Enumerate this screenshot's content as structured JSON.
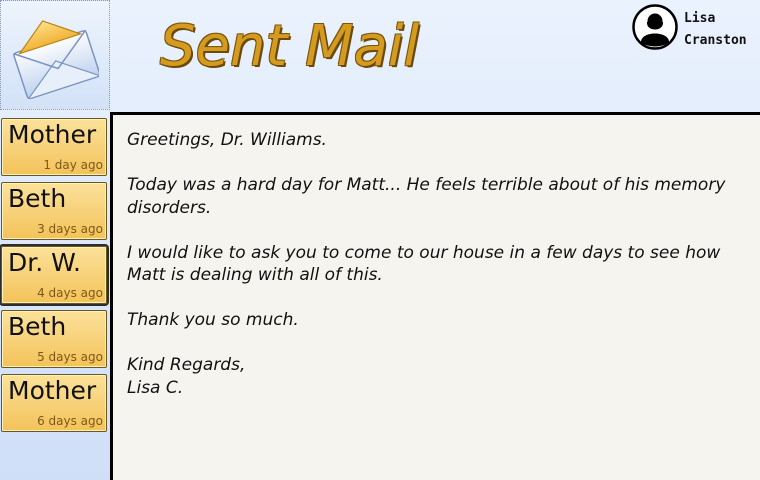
{
  "header": {
    "title": "Sent Mail",
    "logo_icon": "envelope-icon",
    "user": {
      "first_name": "Lisa",
      "last_name": "Cranston",
      "avatar_icon": "user-silhouette-icon"
    }
  },
  "sidebar": {
    "items": [
      {
        "name": "Mother",
        "time": "1 day ago",
        "active": false
      },
      {
        "name": "Beth",
        "time": "3 days ago",
        "active": false
      },
      {
        "name": "Dr. W.",
        "time": "4 days ago",
        "active": true
      },
      {
        "name": "Beth",
        "time": "5 days ago",
        "active": false
      },
      {
        "name": "Mother",
        "time": "6 days ago",
        "active": false
      }
    ]
  },
  "message": {
    "greeting": "Greetings, Dr. Williams.",
    "paragraph1": "Today was a hard day for Matt... He feels terrible about of his memory disorders.",
    "paragraph2": "I would like to ask you to come to our house in a few days to see how Matt is dealing with all of this.",
    "paragraph3": "Thank you so much.",
    "closing": "Kind Regards,",
    "signature": "Lisa C."
  },
  "colors": {
    "title": "#d49b1f",
    "contact_card": "#f4c25a",
    "pane_background": "#f6f4ef",
    "header_background": "#dbe7fb"
  }
}
